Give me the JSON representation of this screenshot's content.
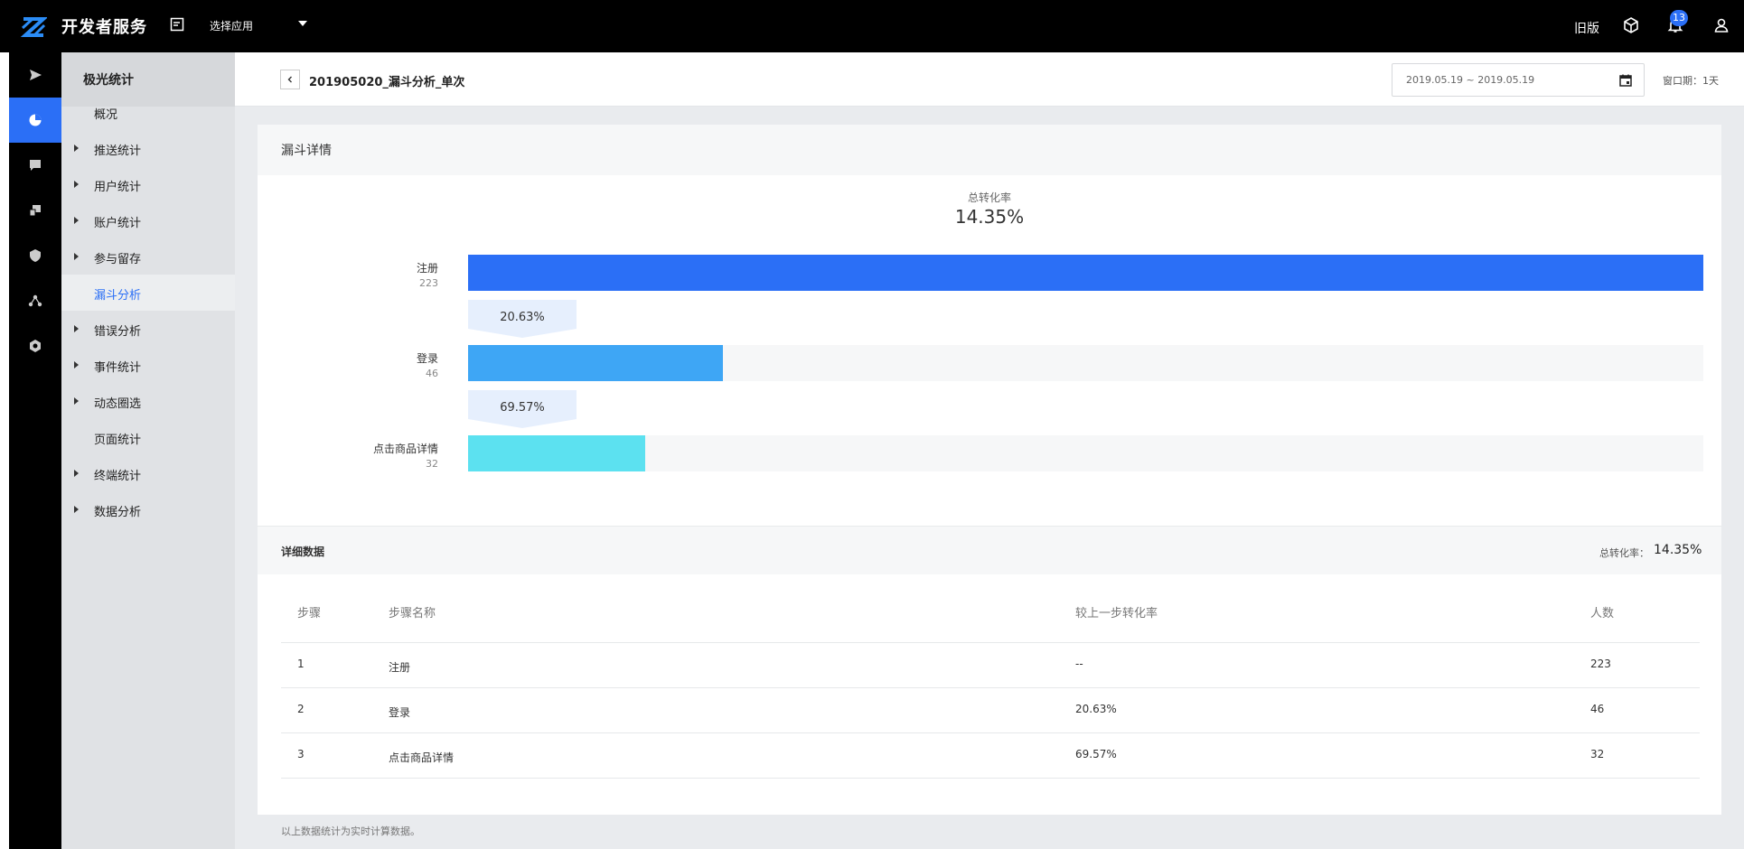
{
  "topbar": {
    "brand": "开发者服务",
    "app_select": "选择应用",
    "old_version": "旧版",
    "notification_count": "13"
  },
  "rail": {
    "items": [
      "send-icon",
      "stats-icon",
      "message-icon",
      "device-icon",
      "shield-icon",
      "nodes-icon",
      "gear-icon"
    ],
    "active": "stats-icon"
  },
  "subnav": {
    "title": "极光统计",
    "items": [
      {
        "label": "概况",
        "has_arrow": false
      },
      {
        "label": "推送统计",
        "has_arrow": true
      },
      {
        "label": "用户统计",
        "has_arrow": true
      },
      {
        "label": "账户统计",
        "has_arrow": true
      },
      {
        "label": "参与留存",
        "has_arrow": true
      },
      {
        "label": "漏斗分析",
        "has_arrow": false,
        "active": true
      },
      {
        "label": "错误分析",
        "has_arrow": true
      },
      {
        "label": "事件统计",
        "has_arrow": true
      },
      {
        "label": "动态圈选",
        "has_arrow": true
      },
      {
        "label": "页面统计",
        "has_arrow": false
      },
      {
        "label": "终端统计",
        "has_arrow": true
      },
      {
        "label": "数据分析",
        "has_arrow": true
      }
    ]
  },
  "header": {
    "title": "201905020_漏斗分析_单次",
    "date_range": "2019.05.19 ~ 2019.05.19",
    "window_period": "窗口期：1天"
  },
  "funnel": {
    "section_title": "漏斗详情",
    "total_label": "总转化率",
    "total_value": "14.35%",
    "steps": [
      {
        "name": "注册",
        "count": "223",
        "fraction": 1.0,
        "color": "#2b6ff6"
      },
      {
        "name": "登录",
        "count": "46",
        "fraction": 0.2063,
        "color": "#3ea6f5"
      },
      {
        "name": "点击商品详情",
        "count": "32",
        "fraction": 0.1435,
        "color": "#5ce1f0"
      }
    ],
    "rates": [
      "20.63%",
      "69.57%"
    ]
  },
  "detail": {
    "title": "详细数据",
    "total_label": "总转化率：",
    "total_value": "14.35%",
    "columns": [
      "步骤",
      "步骤名称",
      "较上一步转化率",
      "人数"
    ],
    "rows": [
      [
        "1",
        "注册",
        "--",
        "223"
      ],
      [
        "2",
        "登录",
        "20.63%",
        "46"
      ],
      [
        "3",
        "点击商品详情",
        "69.57%",
        "32"
      ]
    ]
  },
  "footer_note": "以上数据统计为实时计算数据。"
}
